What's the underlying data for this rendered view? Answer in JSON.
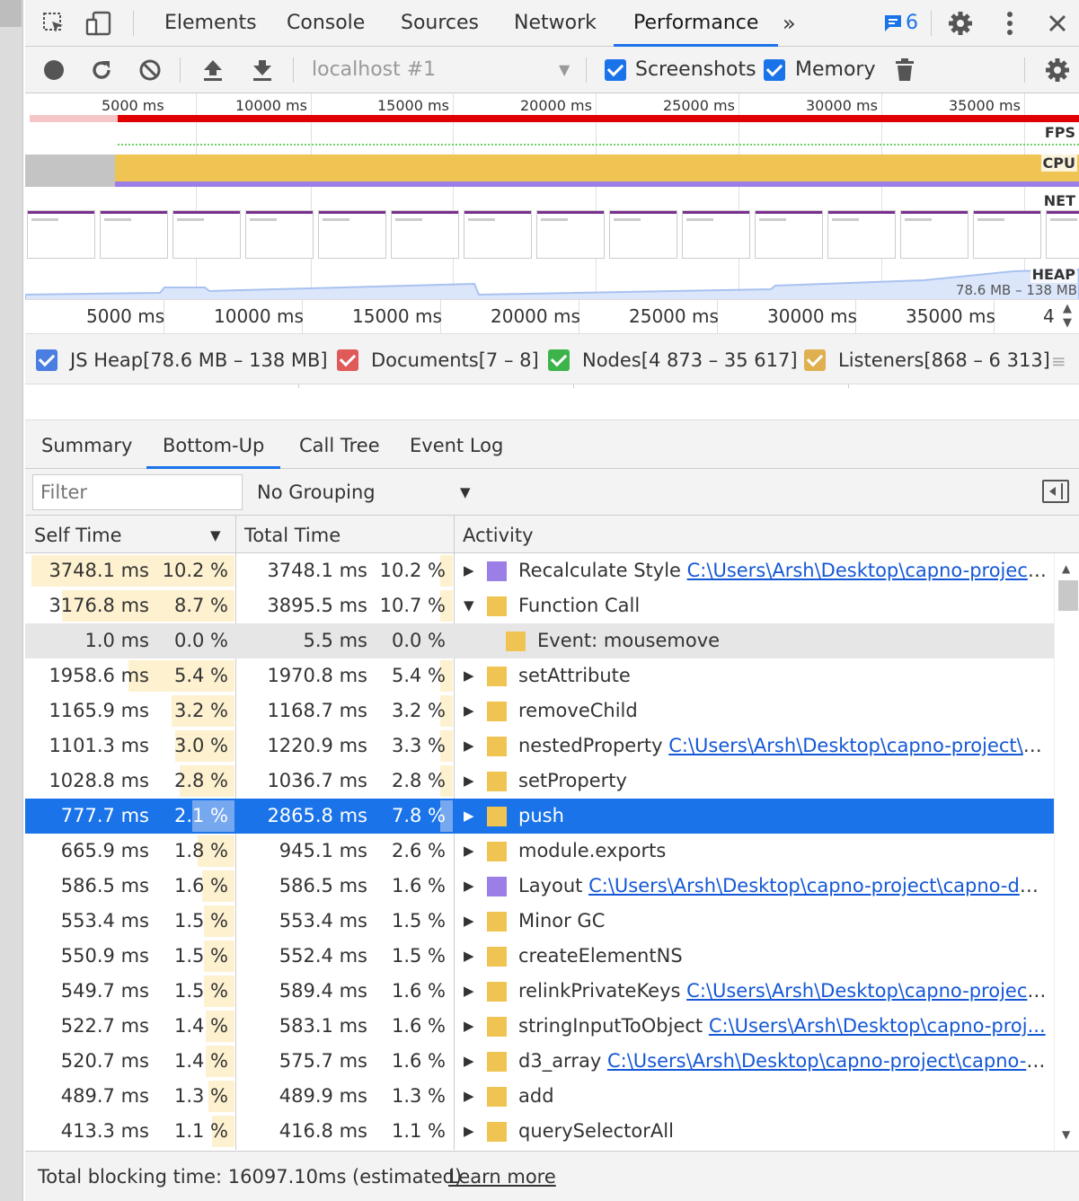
{
  "tabs": {
    "elements": "Elements",
    "console": "Console",
    "sources": "Sources",
    "network": "Network",
    "performance": "Performance",
    "issues_count": "6"
  },
  "toolbar": {
    "target": "localhost #1",
    "screenshots_label": "Screenshots",
    "memory_label": "Memory",
    "screenshots_checked": true,
    "memory_checked": true
  },
  "overview": {
    "ruler": [
      "5000 ms",
      "10000 ms",
      "15000 ms",
      "20000 ms",
      "25000 ms",
      "30000 ms",
      "35000 ms"
    ],
    "tracks": {
      "fps": "FPS",
      "cpu": "CPU",
      "net": "NET",
      "heap": "HEAP"
    },
    "heap_range": "78.6 MB – 138 MB",
    "colors": {
      "long_task": "#e00000",
      "scripting": "#f0c453",
      "rendering": "#9b7fe6",
      "idle": "#c4c4c4",
      "heap": "#a9c2f0",
      "fps": "#6ed164"
    }
  },
  "timeruler": [
    "5000 ms",
    "10000 ms",
    "15000 ms",
    "20000 ms",
    "25000 ms",
    "30000 ms",
    "35000 ms",
    "4"
  ],
  "counters": [
    {
      "label": "JS Heap[78.6 MB – 138 MB]",
      "color": "#4a7ee0"
    },
    {
      "label": "Documents[7 – 8]",
      "color": "#e05a5a"
    },
    {
      "label": "Nodes[4 873 – 35 617]",
      "color": "#3cb44b"
    },
    {
      "label": "Listeners[868 – 6 313]",
      "color": "#e0b050"
    }
  ],
  "subtabs": {
    "summary": "Summary",
    "bottom_up": "Bottom-Up",
    "call_tree": "Call Tree",
    "event_log": "Event Log"
  },
  "filter": {
    "placeholder": "Filter",
    "grouping": "No Grouping"
  },
  "table": {
    "headers": {
      "self_time": "Self Time",
      "total_time": "Total Time",
      "activity": "Activity"
    },
    "rows": [
      {
        "self": "3748.1 ms",
        "self_pct": "10.2 %",
        "self_frac": 1.0,
        "total": "3748.1 ms",
        "total_pct": "10.2 %",
        "total_frac": 0.06,
        "name": "Recalculate Style",
        "link": "C:\\Users\\Arsh\\Desktop\\capno-project\\...",
        "color": "#9b7fe6",
        "caret": "right",
        "indent": 0
      },
      {
        "self": "3176.8 ms",
        "self_pct": "8.7 %",
        "self_frac": 0.85,
        "total": "3895.5 ms",
        "total_pct": "10.7 %",
        "total_frac": 0.06,
        "name": "Function Call",
        "link": "",
        "color": "#f0c453",
        "caret": "down",
        "indent": 0
      },
      {
        "self": "1.0 ms",
        "self_pct": "0.0 %",
        "self_frac": 0.0,
        "total": "5.5 ms",
        "total_pct": "0.0 %",
        "total_frac": 0.0,
        "name": "Event: mousemove",
        "link": "",
        "color": "#f0c453",
        "caret": "",
        "indent": 1
      },
      {
        "self": "1958.6 ms",
        "self_pct": "5.4 %",
        "self_frac": 0.52,
        "total": "1970.8 ms",
        "total_pct": "5.4 %",
        "total_frac": 0.06,
        "name": "setAttribute",
        "link": "",
        "color": "#f0c453",
        "caret": "right",
        "indent": 0
      },
      {
        "self": "1165.9 ms",
        "self_pct": "3.2 %",
        "self_frac": 0.31,
        "total": "1168.7 ms",
        "total_pct": "3.2 %",
        "total_frac": 0.06,
        "name": "removeChild",
        "link": "",
        "color": "#f0c453",
        "caret": "right",
        "indent": 0
      },
      {
        "self": "1101.3 ms",
        "self_pct": "3.0 %",
        "self_frac": 0.29,
        "total": "1220.9 ms",
        "total_pct": "3.3 %",
        "total_frac": 0.06,
        "name": "nestedProperty",
        "link": "C:\\Users\\Arsh\\Desktop\\capno-project\\c...",
        "color": "#f0c453",
        "caret": "right",
        "indent": 0
      },
      {
        "self": "1028.8 ms",
        "self_pct": "2.8 %",
        "self_frac": 0.27,
        "total": "1036.7 ms",
        "total_pct": "2.8 %",
        "total_frac": 0.06,
        "name": "setProperty",
        "link": "",
        "color": "#f0c453",
        "caret": "right",
        "indent": 0
      },
      {
        "self": "777.7 ms",
        "self_pct": "2.1 %",
        "self_frac": 0.21,
        "total": "2865.8 ms",
        "total_pct": "7.8 %",
        "total_frac": 0.06,
        "name": "push",
        "link": "",
        "color": "#f0c453",
        "caret": "right",
        "indent": 0,
        "selected": true
      },
      {
        "self": "665.9 ms",
        "self_pct": "1.8 %",
        "self_frac": 0.18,
        "total": "945.1 ms",
        "total_pct": "2.6 %",
        "total_frac": 0.0,
        "name": "module.exports",
        "link": "",
        "color": "#f0c453",
        "caret": "right",
        "indent": 0
      },
      {
        "self": "586.5 ms",
        "self_pct": "1.6 %",
        "self_frac": 0.16,
        "total": "586.5 ms",
        "total_pct": "1.6 %",
        "total_frac": 0.0,
        "name": "Layout",
        "link": "C:\\Users\\Arsh\\Desktop\\capno-project\\capno-de...",
        "color": "#9b7fe6",
        "caret": "right",
        "indent": 0
      },
      {
        "self": "553.4 ms",
        "self_pct": "1.5 %",
        "self_frac": 0.15,
        "total": "553.4 ms",
        "total_pct": "1.5 %",
        "total_frac": 0.0,
        "name": "Minor GC",
        "link": "",
        "color": "#f0c453",
        "caret": "right",
        "indent": 0
      },
      {
        "self": "550.9 ms",
        "self_pct": "1.5 %",
        "self_frac": 0.15,
        "total": "552.4 ms",
        "total_pct": "1.5 %",
        "total_frac": 0.0,
        "name": "createElementNS",
        "link": "",
        "color": "#f0c453",
        "caret": "right",
        "indent": 0
      },
      {
        "self": "549.7 ms",
        "self_pct": "1.5 %",
        "self_frac": 0.15,
        "total": "589.4 ms",
        "total_pct": "1.6 %",
        "total_frac": 0.0,
        "name": "relinkPrivateKeys",
        "link": "C:\\Users\\Arsh\\Desktop\\capno-project\\...",
        "color": "#f0c453",
        "caret": "right",
        "indent": 0
      },
      {
        "self": "522.7 ms",
        "self_pct": "1.4 %",
        "self_frac": 0.14,
        "total": "583.1 ms",
        "total_pct": "1.6 %",
        "total_frac": 0.0,
        "name": "stringInputToObject",
        "link": "C:\\Users\\Arsh\\Desktop\\capno-proj...",
        "color": "#f0c453",
        "caret": "right",
        "indent": 0
      },
      {
        "self": "520.7 ms",
        "self_pct": "1.4 %",
        "self_frac": 0.14,
        "total": "575.7 ms",
        "total_pct": "1.6 %",
        "total_frac": 0.0,
        "name": "d3_array",
        "link": "C:\\Users\\Arsh\\Desktop\\capno-project\\capno-d...",
        "color": "#f0c453",
        "caret": "right",
        "indent": 0
      },
      {
        "self": "489.7 ms",
        "self_pct": "1.3 %",
        "self_frac": 0.13,
        "total": "489.9 ms",
        "total_pct": "1.3 %",
        "total_frac": 0.0,
        "name": "add",
        "link": "",
        "color": "#f0c453",
        "caret": "right",
        "indent": 0
      },
      {
        "self": "413.3 ms",
        "self_pct": "1.1 %",
        "self_frac": 0.11,
        "total": "416.8 ms",
        "total_pct": "1.1 %",
        "total_frac": 0.0,
        "name": "querySelectorAll",
        "link": "",
        "color": "#f0c453",
        "caret": "right",
        "indent": 0
      }
    ]
  },
  "footer": {
    "text": "Total blocking time: 16097.10ms (estimated)",
    "learn_more": "Learn more"
  }
}
